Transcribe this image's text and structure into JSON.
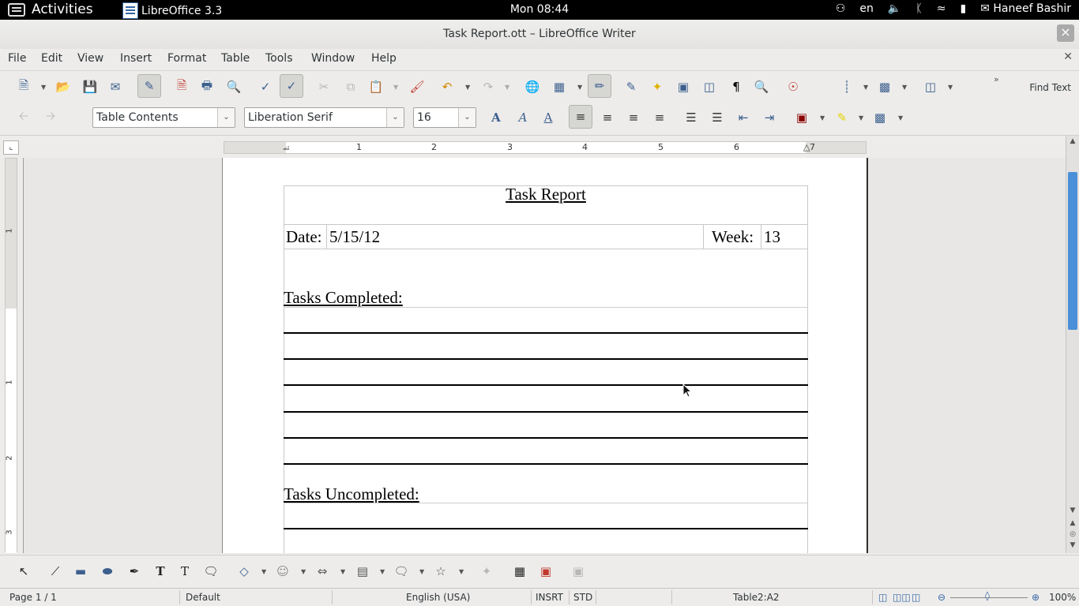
{
  "topbar": {
    "activities": "Activities",
    "app_name": "LibreOffice 3.3",
    "clock": "Mon 08:44",
    "lang": "en",
    "user": "Haneef Bashir"
  },
  "window": {
    "title": "Task Report.ott – LibreOffice Writer"
  },
  "menu": {
    "items": [
      "File",
      "Edit",
      "View",
      "Insert",
      "Format",
      "Table",
      "Tools",
      "Window",
      "Help"
    ]
  },
  "toolbar": {
    "find_text": "Find Text"
  },
  "format": {
    "style": "Table Contents",
    "font": "Liberation Serif",
    "size": "16"
  },
  "ruler": {
    "marks": [
      "1",
      "2",
      "3",
      "4",
      "5",
      "6",
      "7"
    ],
    "vmarks": [
      "1",
      "1",
      "2",
      "3"
    ]
  },
  "document": {
    "heading": "Task Report",
    "date_label": "Date:",
    "date_value": "5/15/12",
    "week_label": "Week:",
    "week_value": "13",
    "completed_label": "Tasks Completed:",
    "uncompleted_label": "Tasks Uncompleted:"
  },
  "status": {
    "page": "Page 1 / 1",
    "style": "Default",
    "language": "English (USA)",
    "insert_mode": "INSRT",
    "selection_mode": "STD",
    "cell": "Table2:A2",
    "zoom": "100%"
  }
}
